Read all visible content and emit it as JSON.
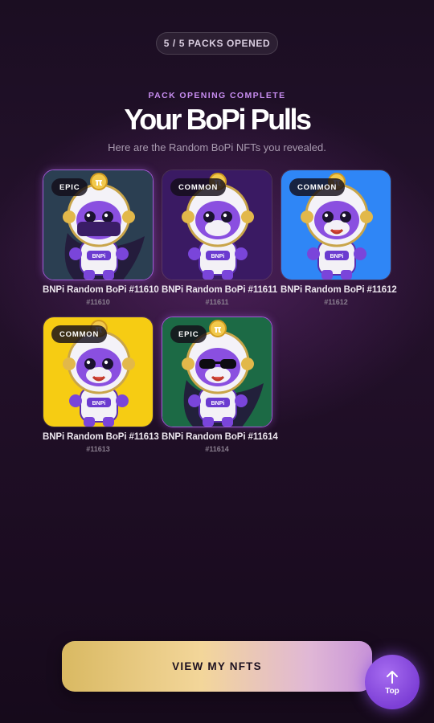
{
  "progress": {
    "label": "5 / 5 PACKS OPENED",
    "opened": 5,
    "total": 5
  },
  "header": {
    "kicker": "PACK OPENING COMPLETE",
    "title": "Your BoPi Pulls",
    "subtitle": "Here are the Random BoPi NFTs you revealed."
  },
  "cards": [
    {
      "rarity": "EPIC",
      "name": "BNPi Random BoPi #11610",
      "number": "#11610",
      "bg": "#2b3f52",
      "visor": "mask"
    },
    {
      "rarity": "COMMON",
      "name": "BNPi Random BoPi #11611",
      "number": "#11611",
      "bg": "#3a1a63",
      "visor": "plain"
    },
    {
      "rarity": "COMMON",
      "name": "BNPi Random BoPi #11612",
      "number": "#11612",
      "bg": "#2f86f6",
      "visor": "smile"
    },
    {
      "rarity": "COMMON",
      "name": "BNPi Random BoPi #11613",
      "number": "#11613",
      "bg": "#f6cc13",
      "visor": "wink"
    },
    {
      "rarity": "EPIC",
      "name": "BNPi Random BoPi #11614",
      "number": "#11614",
      "bg": "#1c6a45",
      "visor": "shades"
    }
  ],
  "badge_text": "BNPi",
  "cta": {
    "label": "VIEW MY NFTS"
  },
  "scroll_top": {
    "label": "Top",
    "icon": "arrow-up-icon"
  },
  "colors": {
    "accent": "#8b4ae0",
    "kicker": "#c78df0",
    "cta_gold": "#f3d69a",
    "cta_pink": "#c893d8"
  }
}
